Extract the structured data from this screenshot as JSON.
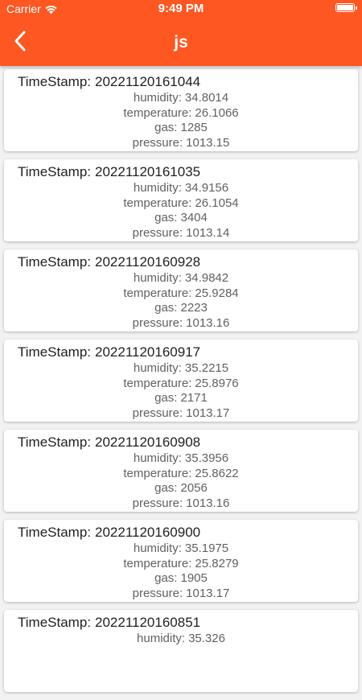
{
  "status_bar": {
    "carrier": "Carrier",
    "time": "9:49 PM"
  },
  "header": {
    "title": "js",
    "color": "#fe5722"
  },
  "labels": {
    "timestamp": "TimeStamp:",
    "humidity": "humidity:",
    "temperature": "temperature:",
    "gas": "gas:",
    "pressure": "pressure:"
  },
  "records": [
    {
      "timestamp": "20221120161044",
      "humidity": "34.8014",
      "temperature": "26.1066",
      "gas": "1285",
      "pressure": "1013.15"
    },
    {
      "timestamp": "20221120161035",
      "humidity": "34.9156",
      "temperature": "26.1054",
      "gas": "3404",
      "pressure": "1013.14"
    },
    {
      "timestamp": "20221120160928",
      "humidity": "34.9842",
      "temperature": "25.9284",
      "gas": "2223",
      "pressure": "1013.16"
    },
    {
      "timestamp": "20221120160917",
      "humidity": "35.2215",
      "temperature": "25.8976",
      "gas": "2171",
      "pressure": "1013.17"
    },
    {
      "timestamp": "20221120160908",
      "humidity": "35.3956",
      "temperature": "25.8622",
      "gas": "2056",
      "pressure": "1013.16"
    },
    {
      "timestamp": "20221120160900",
      "humidity": "35.1975",
      "temperature": "25.8279",
      "gas": "1905",
      "pressure": "1013.17"
    },
    {
      "timestamp": "20221120160851",
      "humidity": "35.326"
    }
  ]
}
